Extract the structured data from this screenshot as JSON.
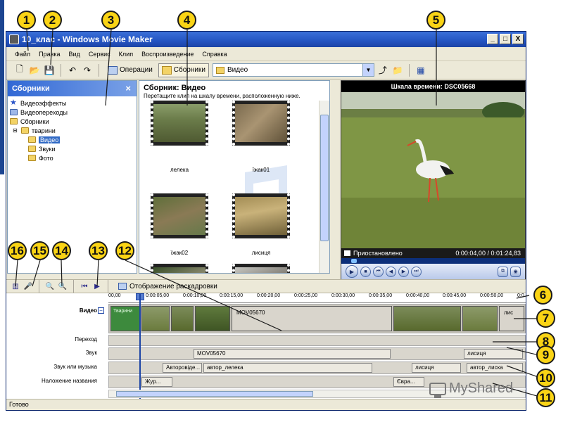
{
  "window": {
    "title": "10_клас - Windows Movie Maker",
    "controls": [
      "_",
      "□",
      "X"
    ]
  },
  "menu": [
    "Файл",
    "Правка",
    "Вид",
    "Сервис",
    "Клип",
    "Воспроизведение",
    "Справка"
  ],
  "toolbar": {
    "operations_label": "Операции",
    "collections_label": "Сборники",
    "combo_value": "Видео"
  },
  "collections_pane": {
    "title": "Сборники",
    "close": "×",
    "items": [
      {
        "label": "Видеоэффекты",
        "icon": "star-icon"
      },
      {
        "label": "Видеопереходы",
        "icon": "film-icon"
      },
      {
        "label": "Сборники",
        "icon": "folder-icon"
      },
      {
        "label": "тварини",
        "icon": "folder-icon"
      },
      {
        "label": "Видео",
        "icon": "folder-icon"
      },
      {
        "label": "Звуки",
        "icon": "folder-icon"
      },
      {
        "label": "Фото",
        "icon": "folder-icon"
      }
    ]
  },
  "clip_pane": {
    "title": "Сборник: Видео",
    "subtitle": "Перетащите клип на шкалу времени, расположенную ниже.",
    "clips": [
      {
        "label": "лелека"
      },
      {
        "label": "їжак01"
      },
      {
        "label": "їжак02"
      },
      {
        "label": "лисиця"
      },
      {
        "label": ""
      },
      {
        "label": ""
      }
    ]
  },
  "monitor": {
    "title": "Шкала времени: DSC05668",
    "status": "Приостановлено",
    "time": "0:00:04,00 / 0:01:24,83",
    "buttons": [
      "▶",
      "■",
      "⏮",
      "◀",
      "▶",
      "⏭"
    ]
  },
  "storyboard_toolbar": {
    "label": "Отображение раскадровки"
  },
  "timeline": {
    "ticks": [
      "00,00",
      "0:00:05,00",
      "0:00:10,00",
      "0:00:15,00",
      "0:00:20,00",
      "0:00:25,00",
      "0:00:30,00",
      "0:00:35,00",
      "0:00:40,00",
      "0:00:45,00",
      "0:00:50,00",
      "0:0"
    ],
    "track_labels": {
      "video": "Видео",
      "transitions": "Переход",
      "audio": "Звук",
      "music": "Звук или музыка",
      "titles": "Наложение названия"
    },
    "video_clips": {
      "title_clip": "Тварини",
      "long_clip": "MOV05670",
      "tail_clip": "лис"
    },
    "audio_clips": {
      "main": "MOV05670",
      "tail": "лисиця"
    },
    "music_clips": {
      "a": "Авторовіде...",
      "b": "автор_лелека",
      "c": "лисиця",
      "d": "автор_лиска"
    },
    "title_clips": {
      "a": "Жур...",
      "b": "Євра..."
    }
  },
  "status_bar": "Готово",
  "watermark": "MyShared",
  "callouts": [
    "1",
    "2",
    "3",
    "4",
    "5",
    "6",
    "7",
    "8",
    "9",
    "10",
    "11",
    "12",
    "13",
    "14",
    "15",
    "16"
  ],
  "colors": {
    "callout_fill": "#fad415",
    "titlebar": "#2454c2",
    "selection": "#316ac5"
  }
}
